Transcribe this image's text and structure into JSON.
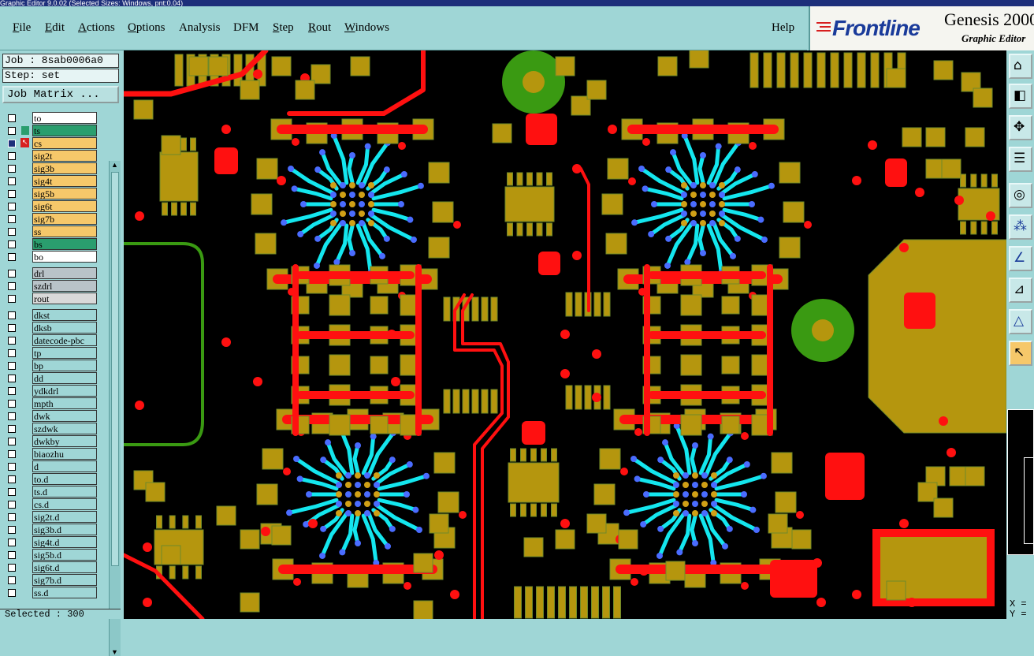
{
  "window": {
    "title": "Graphic Editor 9.0.02 (Selected Sizes: Windows, pnt:0.04)"
  },
  "menu": {
    "items": [
      {
        "u": "F",
        "rest": "ile"
      },
      {
        "u": "E",
        "rest": "dit"
      },
      {
        "u": "A",
        "rest": "ctions"
      },
      {
        "u": "O",
        "rest": "ptions"
      },
      {
        "u": "",
        "rest": "Analysis"
      },
      {
        "u": "",
        "rest": "DFM"
      },
      {
        "u": "S",
        "rest": "tep"
      },
      {
        "u": "R",
        "rest": "out"
      },
      {
        "u": "W",
        "rest": "indows"
      }
    ],
    "help": "Help"
  },
  "brand": {
    "logo_text": "Frontline",
    "product": "Genesis 2000",
    "subtitle": "Graphic Editor"
  },
  "job": {
    "job_label": "Job : 8sab0006a0",
    "step_label": "Step: set",
    "matrix_button": "Job Matrix ..."
  },
  "layers": [
    {
      "name": "to",
      "color": "#ffffff",
      "mark": ""
    },
    {
      "name": "ts",
      "color": "#2a9e6e",
      "mark": ""
    },
    {
      "name": "cs",
      "color": "#f6c86a",
      "mark": "active"
    },
    {
      "name": "sig2t",
      "color": "#f6c86a",
      "mark": ""
    },
    {
      "name": "sig3b",
      "color": "#f6c86a",
      "mark": ""
    },
    {
      "name": "sig4t",
      "color": "#f6c86a",
      "mark": ""
    },
    {
      "name": "sig5b",
      "color": "#f6c86a",
      "mark": ""
    },
    {
      "name": "sig6t",
      "color": "#f6c86a",
      "mark": ""
    },
    {
      "name": "sig7b",
      "color": "#f6c86a",
      "mark": ""
    },
    {
      "name": "ss",
      "color": "#f6c86a",
      "mark": ""
    },
    {
      "name": "bs",
      "color": "#2a9e6e",
      "mark": ""
    },
    {
      "name": "bo",
      "color": "#ffffff",
      "mark": ""
    },
    {
      "name": "drl",
      "color": "#b9c3c8",
      "mark": ""
    },
    {
      "name": "szdrl",
      "color": "#b9c3c8",
      "mark": ""
    },
    {
      "name": "rout",
      "color": "#d9d9d9",
      "mark": ""
    },
    {
      "name": "dkst",
      "color": "#9fd6d6",
      "mark": ""
    },
    {
      "name": "dksb",
      "color": "#9fd6d6",
      "mark": ""
    },
    {
      "name": "datecode-pbc",
      "color": "#9fd6d6",
      "mark": ""
    },
    {
      "name": "tp",
      "color": "#9fd6d6",
      "mark": ""
    },
    {
      "name": "bp",
      "color": "#9fd6d6",
      "mark": ""
    },
    {
      "name": "dd",
      "color": "#9fd6d6",
      "mark": ""
    },
    {
      "name": "ydkdrl",
      "color": "#9fd6d6",
      "mark": ""
    },
    {
      "name": "mpth",
      "color": "#9fd6d6",
      "mark": ""
    },
    {
      "name": "dwk",
      "color": "#9fd6d6",
      "mark": ""
    },
    {
      "name": "szdwk",
      "color": "#9fd6d6",
      "mark": ""
    },
    {
      "name": "dwkby",
      "color": "#9fd6d6",
      "mark": ""
    },
    {
      "name": "biaozhu",
      "color": "#9fd6d6",
      "mark": ""
    },
    {
      "name": "d",
      "color": "#9fd6d6",
      "mark": ""
    },
    {
      "name": "to.d",
      "color": "#9fd6d6",
      "mark": ""
    },
    {
      "name": "ts.d",
      "color": "#9fd6d6",
      "mark": ""
    },
    {
      "name": "cs.d",
      "color": "#9fd6d6",
      "mark": ""
    },
    {
      "name": "sig2t.d",
      "color": "#9fd6d6",
      "mark": ""
    },
    {
      "name": "sig3b.d",
      "color": "#9fd6d6",
      "mark": ""
    },
    {
      "name": "sig4t.d",
      "color": "#9fd6d6",
      "mark": ""
    },
    {
      "name": "sig5b.d",
      "color": "#9fd6d6",
      "mark": ""
    },
    {
      "name": "sig6t.d",
      "color": "#9fd6d6",
      "mark": ""
    },
    {
      "name": "sig7b.d",
      "color": "#9fd6d6",
      "mark": ""
    },
    {
      "name": "ss.d",
      "color": "#9fd6d6",
      "mark": ""
    }
  ],
  "status": {
    "selected": "Selected : 300"
  },
  "coords": {
    "x_label": "X =",
    "y_label": "Y ="
  },
  "tools": [
    "zoom-home-icon",
    "zoom-back-icon",
    "zoom-fit-icon",
    "snap-settings-icon",
    "select-feature-icon",
    "netlist-icon",
    "measure-icon",
    "ruler-icon",
    "drc-icon",
    "pointer-icon"
  ],
  "colors": {
    "copper": "#b5960e",
    "trace": "#ff1010",
    "via": "#ff1010",
    "bga_trace": "#14e6ee",
    "bga_ball": "#4a6cff",
    "ring": "#3a9a12",
    "background": "#000000"
  }
}
